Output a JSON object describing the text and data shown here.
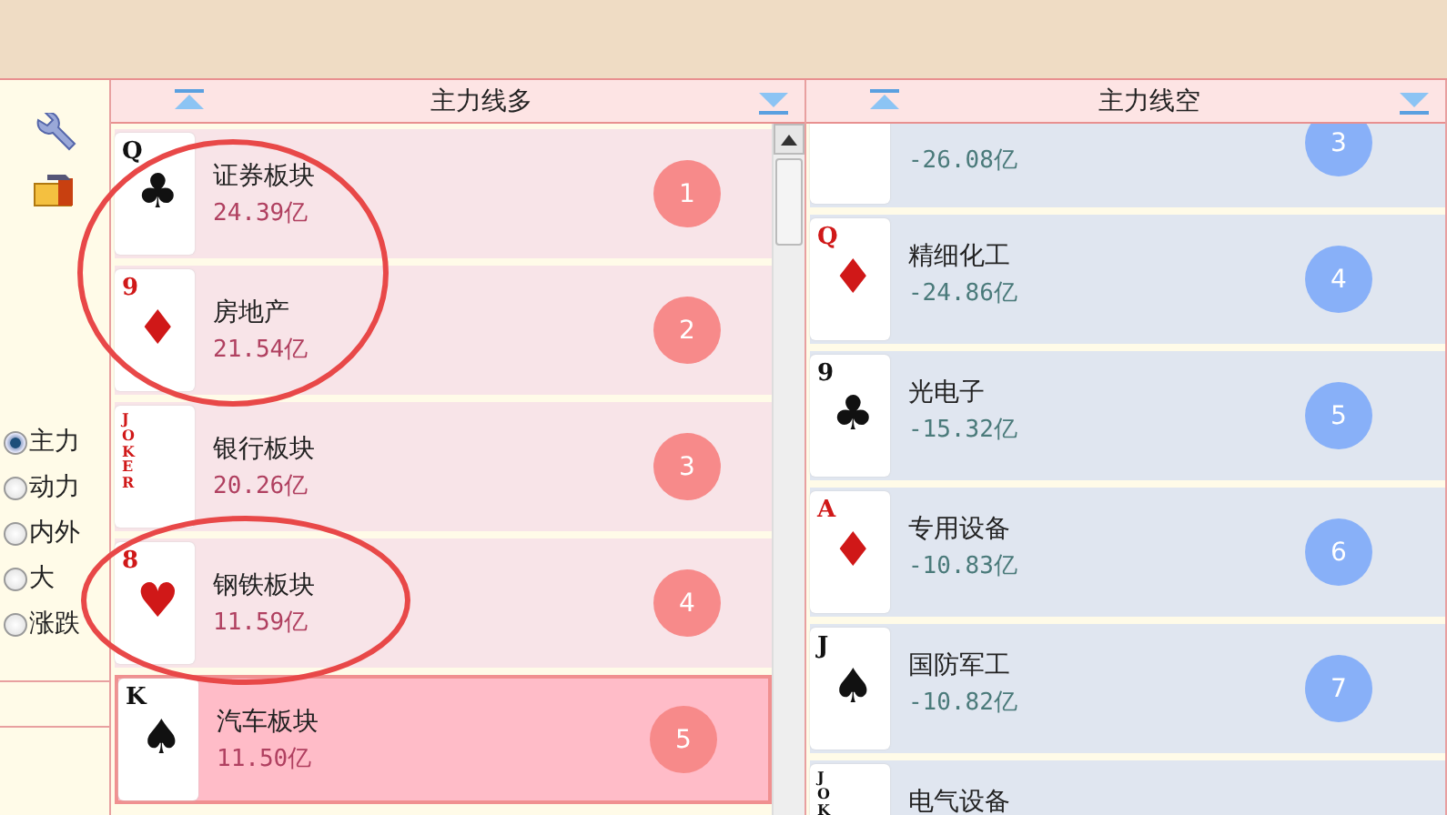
{
  "sidebar": {
    "radios": [
      {
        "label": "主力",
        "selected": true
      },
      {
        "label": "动力",
        "selected": false
      },
      {
        "label": "内外",
        "selected": false
      },
      {
        "label": "大",
        "selected": false
      },
      {
        "label": "涨跌",
        "selected": false
      }
    ]
  },
  "long_panel": {
    "title": "主力线多",
    "rows": [
      {
        "card": {
          "rank": "Q",
          "suit": "♣",
          "red": false
        },
        "name": "证券板块",
        "amount": "24.39亿",
        "rank": "1",
        "selected": false
      },
      {
        "card": {
          "rank": "9",
          "suit": "♦",
          "red": true
        },
        "name": "房地产",
        "amount": "21.54亿",
        "rank": "2",
        "selected": false
      },
      {
        "card": {
          "rank": "JOKER",
          "red": true
        },
        "name": "银行板块",
        "amount": "20.26亿",
        "rank": "3",
        "selected": false
      },
      {
        "card": {
          "rank": "8",
          "suit": "♥",
          "red": true
        },
        "name": "钢铁板块",
        "amount": "11.59亿",
        "rank": "4",
        "selected": false
      },
      {
        "card": {
          "rank": "K",
          "suit": "♠",
          "red": false
        },
        "name": "汽车板块",
        "amount": "11.50亿",
        "rank": "5",
        "selected": true
      }
    ]
  },
  "short_panel": {
    "title": "主力线空",
    "rows": [
      {
        "amount": "-26.08亿",
        "rank": "3"
      },
      {
        "card": {
          "rank": "Q",
          "suit": "♦",
          "red": true
        },
        "name": "精细化工",
        "amount": "-24.86亿",
        "rank": "4"
      },
      {
        "card": {
          "rank": "9",
          "suit": "♣",
          "red": false
        },
        "name": "光电子",
        "amount": "-15.32亿",
        "rank": "5"
      },
      {
        "card": {
          "rank": "A",
          "suit": "♦",
          "red": true
        },
        "name": "专用设备",
        "amount": "-10.83亿",
        "rank": "6"
      },
      {
        "card": {
          "rank": "J",
          "suit": "♠",
          "red": false
        },
        "name": "国防军工",
        "amount": "-10.82亿",
        "rank": "7"
      },
      {
        "card": {
          "rank": "JOK",
          "red": false
        },
        "name": "电气设备"
      }
    ]
  }
}
